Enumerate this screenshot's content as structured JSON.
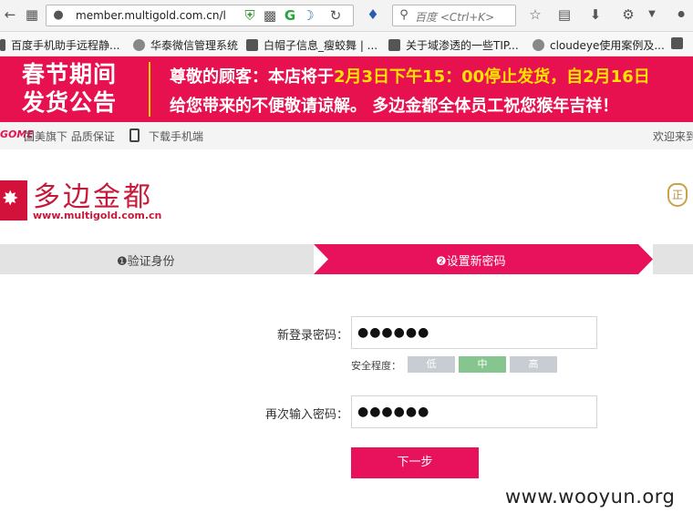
{
  "browser": {
    "url": "member.multigold.com.cn/l",
    "search_placeholder": "百度 <Ctrl+K>",
    "bookmarks": [
      {
        "label": "百度手机助手远程静..."
      },
      {
        "label": "华泰微信管理系统"
      },
      {
        "label": "白帽子信息_瘦蛟舞 | ..."
      },
      {
        "label": "关于域渗透的一些TIP..."
      },
      {
        "label": "cloudeye使用案例及..."
      }
    ]
  },
  "banner": {
    "left_line1": "春节期间",
    "left_line2": "发货公告",
    "line1_prefix": "尊敬的顾客：本店将于",
    "line1_highlight": "2月3日下午15：00停止发货，自2月16日",
    "line2": "给您带来的不便敬请谅解。  多边金都全体员工祝您猴年吉祥！"
  },
  "topstrip": {
    "gome_logo": "GOME",
    "gome_text": "国美旗下 品质保证",
    "download_text": "下载手机端",
    "welcome": "欢迎来到"
  },
  "logo": {
    "cn_name": "多边金都",
    "url": "www.multigold.com.cn",
    "cert_badge": "正"
  },
  "steps": {
    "step1": "❶验证身份",
    "step2": "❷设置新密码"
  },
  "form": {
    "new_password_label": "新登录密码：",
    "new_password_value": "●●●●●●",
    "strength_label": "安全程度：",
    "strength_levels": [
      "低",
      "中",
      "高"
    ],
    "strength_active": "中",
    "confirm_password_label": "再次输入密码：",
    "confirm_password_value": "●●●●●●",
    "next_button": "下一步"
  },
  "watermark": "www.wooyun.org",
  "colors": {
    "brand_pink": "#e8114f",
    "banner_highlight": "#ffe300",
    "strength_active": "#86c58f",
    "strength_inactive": "#c7cdd2"
  }
}
